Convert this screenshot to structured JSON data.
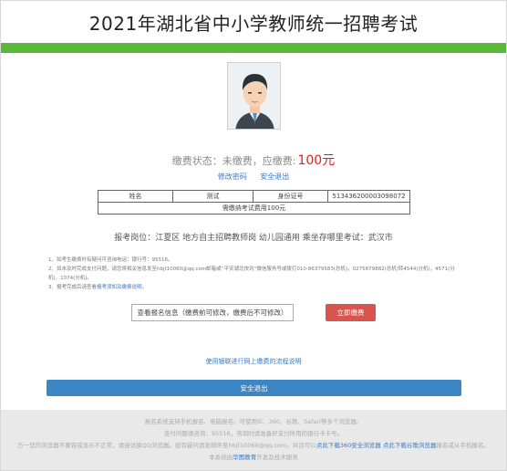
{
  "header": {
    "title": "2021年湖北省中小学教师统一招聘考试"
  },
  "status": {
    "label": "缴费状态：未缴费，应缴费:",
    "fee": "100元"
  },
  "links": {
    "change_password": "修改密码",
    "safe_logout": "安全退出"
  },
  "info_table": {
    "name_label": "姓名",
    "name_value": "测试",
    "id_label": "身份证号",
    "id_value": "513436200003098072",
    "note": "需缴纳考试费用100元"
  },
  "post": {
    "text": "报考岗位：江夏区 地方自主招聘教师岗 幼儿园通用 乘坐存哪里考试：武汉市"
  },
  "notes": {
    "line1": "1、如考生缴费时有疑问可咨询电话：银行号：95516。",
    "line2": "2、如未及时完成支付问题，请您将相关信息发至hbjt10060@qq.com邮箱或“平安湖北快讯”微信服务号或拨打010-86379583(总机)，0275879882(总机)转4544(分机)，4571(分机)，1074(分机)。",
    "line3a": "3、报考完成后请查看",
    "line3_link": "报考须知及缴费说明",
    "line3b": "。"
  },
  "buttons": {
    "modify": "查看报名信息（缴费前可修改，缴费后不可修改）",
    "pay": "立即缴费",
    "guide": "使用银联进行网上缴费的流程说明",
    "logout": "安全退出"
  },
  "footer": {
    "line1": "报名系统支持手机报名、电脑报名。可使用IE、360、谷歌、Safari等多个浏览器。",
    "line2": "支付问题请咨询：95516，咨询时请准备好支付所用的银行卡卡号。",
    "line3a": "万一您的浏览器不兼容或显示不正常，请尝试换QQ浏览器。如有疑问请发邮件至hbjt10060@qq.com。并且可以",
    "line3_link1": "点此下载360安全浏览器",
    "line3_link2": "点此下载谷歌浏览器",
    "line3b": "报名或从手机报名。",
    "line4a": "本系统由",
    "line4_link": "华图教育",
    "line4b": "开发及技术服务"
  },
  "colors": {
    "green": "#5bb93a",
    "red": "#d9231c",
    "blue": "#3d86c6",
    "link": "#3a78c2"
  }
}
